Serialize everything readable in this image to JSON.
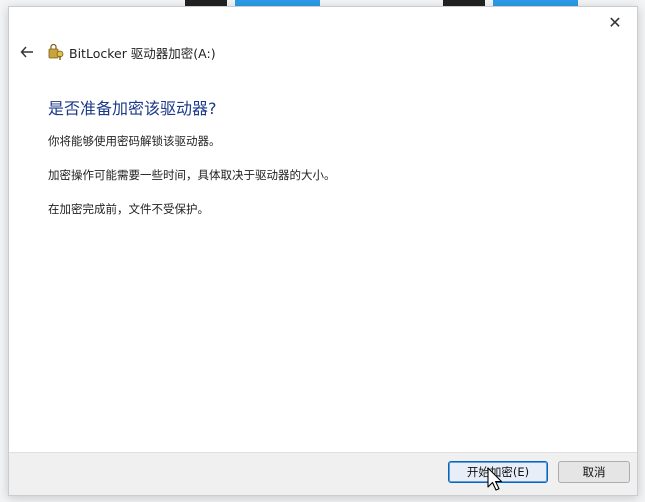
{
  "window": {
    "close_glyph": "✕",
    "back_glyph": "←",
    "title": "BitLocker 驱动器加密(A:)"
  },
  "main": {
    "heading": "是否准备加密该驱动器?",
    "paragraphs": [
      "你将能够使用密码解锁该驱动器。",
      "加密操作可能需要一些时间，具体取决于驱动器的大小。",
      "在加密完成前，文件不受保护。"
    ]
  },
  "footer": {
    "start_label": "开始加密(E)",
    "cancel_label": "取消"
  },
  "colors": {
    "heading": "#1b3a8a",
    "accent": "#0067c0",
    "bg_strip_blue": "#2b9be6"
  },
  "icons": {
    "close": "close-icon",
    "back": "back-arrow-icon",
    "app": "bitlocker-key-icon",
    "cursor": "mouse-pointer-icon"
  }
}
